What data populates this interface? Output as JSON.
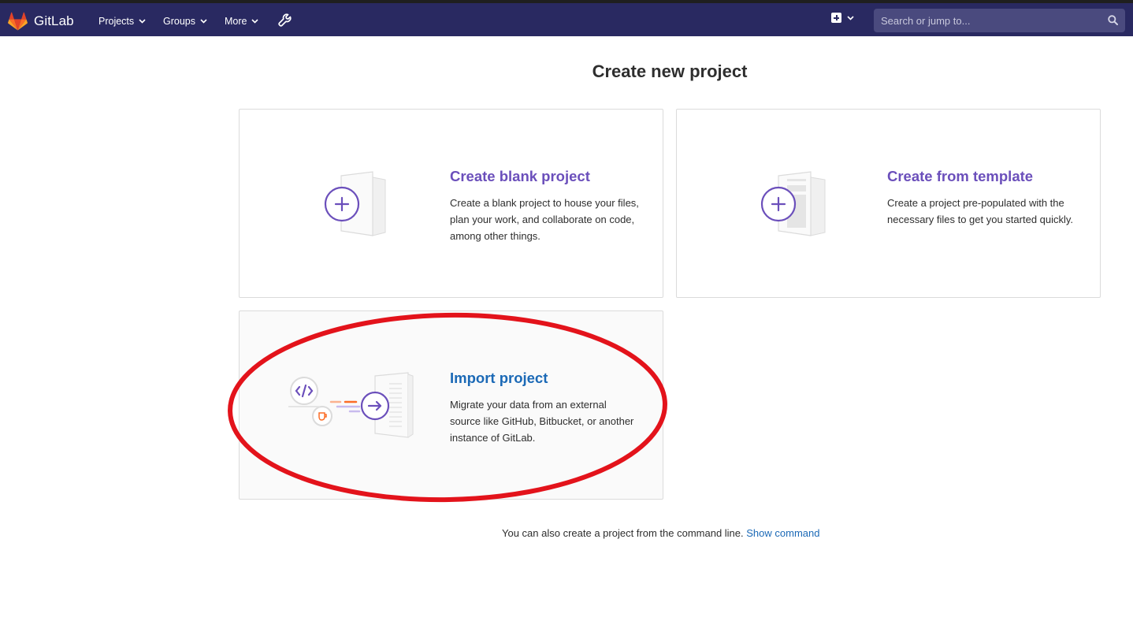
{
  "header": {
    "brand": "GitLab",
    "nav": [
      "Projects",
      "Groups",
      "More"
    ],
    "search_placeholder": "Search or jump to..."
  },
  "main": {
    "title": "Create new project",
    "cards": [
      {
        "title": "Create blank project",
        "description": "Create a blank project to house your files, plan your work, and collaborate on code, among other things."
      },
      {
        "title": "Create from template",
        "description": "Create a project pre-populated with the necessary files to get you started quickly."
      },
      {
        "title": "Import project",
        "description": "Migrate your data from an external source like GitHub, Bitbucket, or another instance of GitLab."
      }
    ],
    "footer_text": "You can also create a project from the command line.",
    "footer_link": "Show command"
  },
  "colors": {
    "navbar": "#292961",
    "accent": "#6b4fbb",
    "link": "#1b69b6",
    "highlight": "#e3131b"
  },
  "icons": [
    "gitlab-logo-icon",
    "chevron-down-icon",
    "wrench-icon",
    "plus-square-icon",
    "search-icon",
    "blank-project-icon",
    "template-icon",
    "import-icon"
  ]
}
